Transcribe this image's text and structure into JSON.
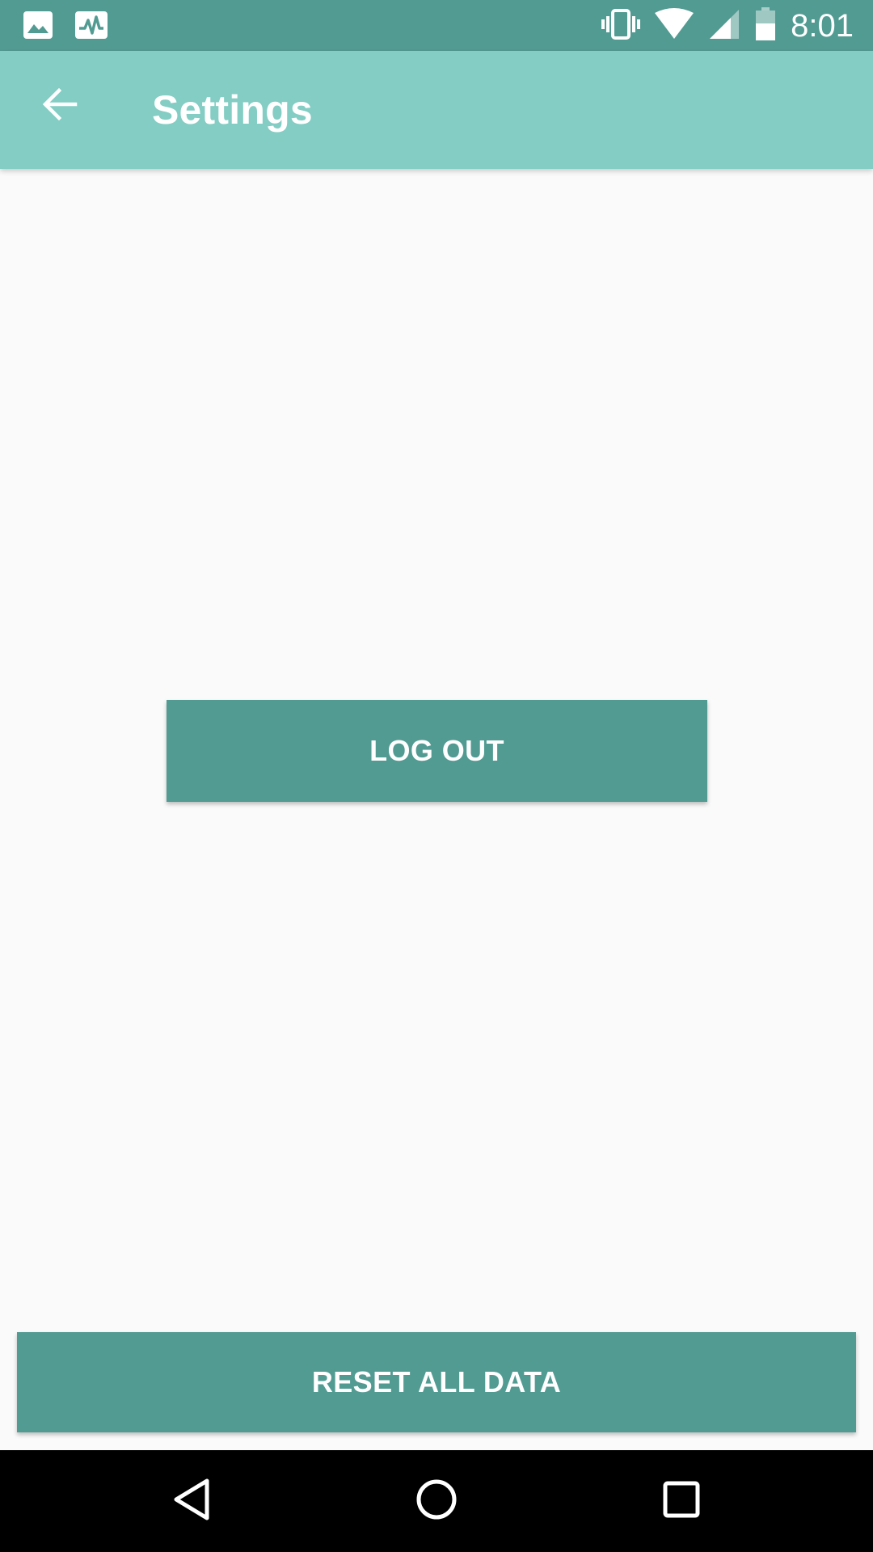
{
  "status_bar": {
    "time": "8:01",
    "icons": [
      "image-notification-icon",
      "activity-notification-icon",
      "vibrate-icon",
      "wifi-icon",
      "cell-signal-icon",
      "battery-icon"
    ]
  },
  "app_bar": {
    "title": "Settings",
    "back_icon": "arrow-back-icon"
  },
  "main": {
    "logout_label": "LOG OUT",
    "reset_label": "RESET ALL DATA"
  },
  "nav_bar": {
    "icons": [
      "nav-back-icon",
      "nav-home-icon",
      "nav-recents-icon"
    ]
  },
  "colors": {
    "status_bar": "#529b93",
    "app_bar": "#83cdc4",
    "button": "#529b93",
    "background": "#fafafa"
  }
}
